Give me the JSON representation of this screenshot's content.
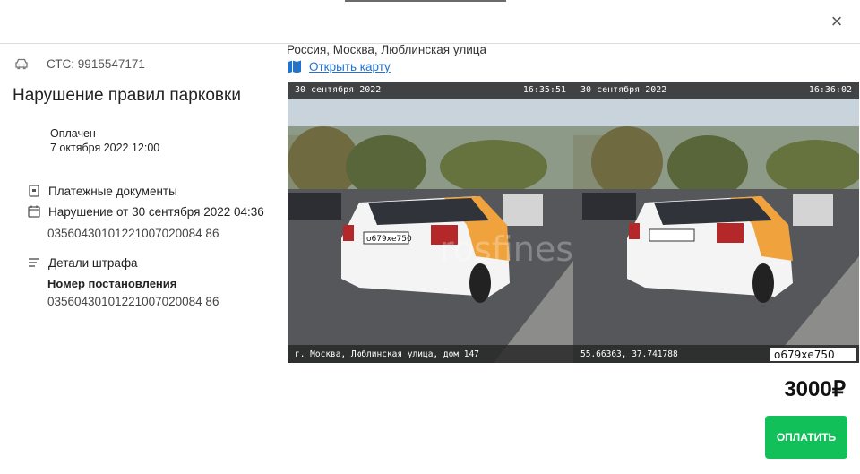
{
  "modal": {
    "close_symbol": "×"
  },
  "left": {
    "sts_label": "СТС: 9915547171",
    "title": "Нарушение правил парковки",
    "paid_status": "Оплачен",
    "paid_date": "7 октября 2022 12:00",
    "payment_docs": "Платежные документы",
    "violation_text": "Нарушение от 30 сентября 2022 04:36",
    "violation_number": "03560430101221007020084 86",
    "fine_details": "Детали штрафа",
    "resolution_header": "Номер постановления",
    "resolution_number": "03560430101221007020084 86"
  },
  "right": {
    "address": "Россия, Москва, Люблинская улица",
    "map_link": "Открыть карту",
    "photo": {
      "frame1": {
        "date": "30 сентября 2022",
        "time": "16:35:51",
        "caption": "г. Москва, Люблинская улица, дом 147",
        "plate": "о679хе750"
      },
      "frame2": {
        "date": "30 сентября 2022",
        "time": "16:36:02",
        "caption": "55.66363, 37.741788",
        "plate_box": "о679хе750"
      },
      "watermark": "rosfines"
    },
    "price": "3000₽",
    "pay_button": "ОПЛАТИТЬ"
  },
  "icons": {
    "car": "car-icon",
    "document": "document-icon",
    "calendar": "calendar-icon",
    "list": "list-icon",
    "map": "map-icon"
  },
  "colors": {
    "accent_green": "#12c05a",
    "link_blue": "#1f73d1"
  }
}
